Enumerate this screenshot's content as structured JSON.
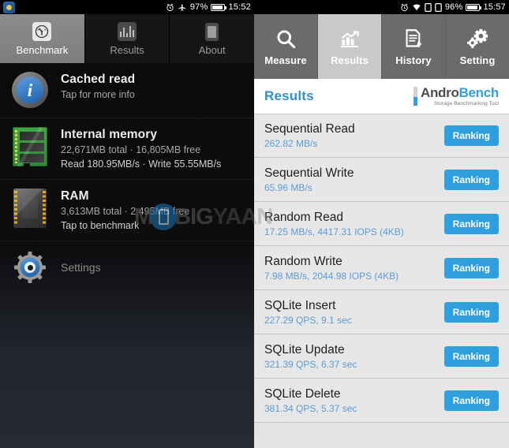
{
  "left_phone": {
    "statusbar": {
      "app_icon": "app-badge-icon",
      "icons": [
        "alarm-icon",
        "airplane-mode-icon"
      ],
      "battery_percent": "97%",
      "time": "15:52"
    },
    "tabs": [
      {
        "label": "Benchmark",
        "icon": "gauge-icon",
        "active": true
      },
      {
        "label": "Results",
        "icon": "bar-chart-icon",
        "active": false
      },
      {
        "label": "About",
        "icon": "phone-icon",
        "active": false
      }
    ],
    "rows": [
      {
        "icon": "info-icon",
        "title": "Cached read",
        "sub": "Tap for more info",
        "sub2": ""
      },
      {
        "icon": "memory-module-icon",
        "title": "Internal memory",
        "sub": "22,671MB total · 16,805MB free",
        "sub2": "Read 180.95MB/s · Write 55.55MB/s"
      },
      {
        "icon": "ram-chip-icon",
        "title": "RAM",
        "sub": "3,613MB total · 2,495MB free",
        "sub2": "Tap to benchmark"
      }
    ],
    "settings": {
      "icon": "gear-eye-icon",
      "label": "Settings"
    }
  },
  "right_phone": {
    "statusbar": {
      "icons": [
        "alarm-icon",
        "wifi-icon",
        "sim1-icon",
        "sim2-icon"
      ],
      "battery_percent": "96%",
      "time": "15:57"
    },
    "tabs": [
      {
        "label": "Measure",
        "icon": "magnifier-icon",
        "active": false
      },
      {
        "label": "Results",
        "icon": "chart-growth-icon",
        "active": true
      },
      {
        "label": "History",
        "icon": "document-edit-icon",
        "active": false
      },
      {
        "label": "Setting",
        "icon": "gears-icon",
        "active": false
      }
    ],
    "header": {
      "title": "Results",
      "logo_part1": "Andro",
      "logo_part2": "Bench",
      "logo_tagline": "Storage Benchmarking Tool"
    },
    "results": [
      {
        "name": "Sequential Read",
        "value": "262.82 MB/s",
        "button": "Ranking"
      },
      {
        "name": "Sequential Write",
        "value": "65.96 MB/s",
        "button": "Ranking"
      },
      {
        "name": "Random Read",
        "value": "17.25 MB/s, 4417.31 IOPS (4KB)",
        "button": "Ranking"
      },
      {
        "name": "Random Write",
        "value": "7.98 MB/s, 2044.98 IOPS (4KB)",
        "button": "Ranking"
      },
      {
        "name": "SQLite Insert",
        "value": "227.29 QPS, 9.1 sec",
        "button": "Ranking"
      },
      {
        "name": "SQLite Update",
        "value": "321.39 QPS, 6.37 sec",
        "button": "Ranking"
      },
      {
        "name": "SQLite Delete",
        "value": "381.34 QPS, 5.37 sec",
        "button": "Ranking"
      }
    ]
  },
  "watermark": {
    "part1": "M",
    "part2": "BIG",
    "part3": "YAAN"
  },
  "colors": {
    "accent_blue": "#2f9fe0",
    "value_blue": "#5b9bd5",
    "left_bg": "#0d0d0f",
    "right_bg": "#e7e7e7",
    "tab_gray": "#6b6b6b",
    "tab_active_gray": "#c9c9c9"
  }
}
